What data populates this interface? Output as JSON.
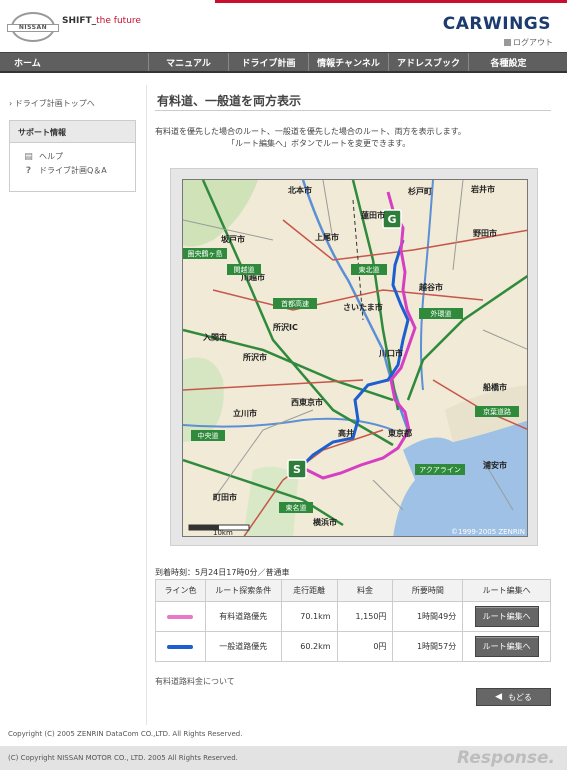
{
  "header": {
    "brand_logo": "NISSAN",
    "tagline_main": "SHIFT_",
    "tagline_sub": "the future",
    "service_logo": "CARWINGS",
    "logout": "ログアウト"
  },
  "nav": {
    "home": "ホーム",
    "manual": "マニュアル",
    "drive_plan": "ドライブ計画",
    "info_channel": "情報チャンネル",
    "address_book": "アドレスブック",
    "settings": "各種設定"
  },
  "sidebar": {
    "top_link": "ドライブ計画トップへ",
    "support_title": "サポート情報",
    "items": [
      {
        "label": "ヘルプ",
        "icon": "document-icon"
      },
      {
        "label": "ドライブ計画Q＆A",
        "icon": "question-icon"
      }
    ]
  },
  "main": {
    "title": "有料道、一般道を両方表示",
    "description_1": "有料道を優先した場合のルート、一般道を優先した場合のルート、両方を表示します。",
    "description_2": "「ルート編集へ」ボタンでルートを変更できます。",
    "arrival": "到着時刻：5月24日17時0分／普通車",
    "table": {
      "headers": [
        "ライン色",
        "ルート探索条件",
        "走行距離",
        "料金",
        "所要時間",
        "ルート編集へ"
      ],
      "rows": [
        {
          "color": "#e878c8",
          "condition": "有料道路優先",
          "distance": "70.1km",
          "fee": "1,150円",
          "time": "1時間49分",
          "button": "ルート編集へ"
        },
        {
          "color": "#1d5fcf",
          "condition": "一般道路優先",
          "distance": "60.2km",
          "fee": "0円",
          "time": "1時間57分",
          "button": "ルート編集へ"
        }
      ]
    },
    "toll_note": "有料道路料金について",
    "back_button": "もどる"
  },
  "map": {
    "copyright": "©1999-2005 ZENRIN",
    "scale": "10km",
    "start_marker": "S",
    "goal_marker": "G",
    "place_labels": [
      "北本市",
      "杉戸町",
      "岩井市",
      "蓮田市",
      "上尾市",
      "野田市",
      "坂戸市",
      "川越市",
      "さいたま市",
      "越谷市",
      "所沢市",
      "入間市",
      "川口市",
      "所沢IC",
      "西東京市",
      "立川市",
      "東京都",
      "高井",
      "町田市",
      "横浜市",
      "浦安市",
      "船橋市"
    ],
    "road_labels": [
      "東北道",
      "関越道",
      "圏央鶴ヶ島",
      "首都高速",
      "外環道",
      "中央道",
      "東名道",
      "京葉道路",
      "アクアライン"
    ],
    "colors": {
      "toll_route": "#e878c8",
      "general_route": "#1d5fcf",
      "marker": "#2e7d3b"
    }
  },
  "footer": {
    "copyright_1": "Copyright (C) 2005 ZENRIN DataCom CO.,LTD. All Rights Reserved.",
    "copyright_2": "(C) Copyright NISSAN MOTOR CO., LTD. 2005 All Rights Reserved.",
    "watermark": "Response."
  }
}
